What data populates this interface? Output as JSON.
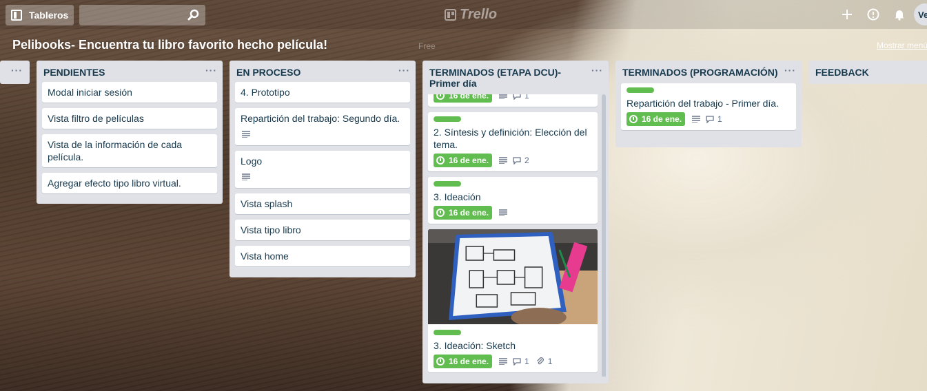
{
  "header": {
    "boards_label": "Tableros",
    "search_placeholder": "",
    "logo_text": "Trello",
    "avatar_initials": "Ve"
  },
  "board": {
    "title": "Pelibooks- Encuentra tu libro favorito hecho película!",
    "faint_label": "Free",
    "show_menu": "Mostrar menú"
  },
  "lists": {
    "pendientes": {
      "title": "PENDIENTES",
      "cards": [
        {
          "title": "Modal iniciar sesión"
        },
        {
          "title": "Vista filtro de películas"
        },
        {
          "title": "Vista de la información de cada película."
        },
        {
          "title": "Agregar efecto tipo libro virtual."
        }
      ]
    },
    "en_proceso": {
      "title": "EN PROCESO",
      "cards": [
        {
          "title": "4. Prototipo"
        },
        {
          "title": "Repartición del trabajo: Segundo día."
        },
        {
          "title": "Logo"
        },
        {
          "title": "Vista splash"
        },
        {
          "title": "Vista tipo libro"
        },
        {
          "title": "Vista home"
        }
      ]
    },
    "terminados_dcu": {
      "title": "TERMINADOS (ETAPA DCU)- Primer día",
      "cards": [
        {
          "due": "16 de ene.",
          "comments": "1"
        },
        {
          "title": "2. Síntesis y definición: Elección del tema.",
          "due": "16 de ene.",
          "comments": "2"
        },
        {
          "title": "3. Ideación",
          "due": "16 de ene."
        },
        {
          "title": "3. Ideación: Sketch",
          "due": "16 de ene.",
          "comments": "1",
          "attachments": "1"
        }
      ]
    },
    "terminados_prog": {
      "title": "TERMINADOS (PROGRAMACIÓN)",
      "cards": [
        {
          "title": "Repartición del trabajo - Primer día.",
          "due": "16 de ene.",
          "comments": "1"
        }
      ]
    },
    "feedback": {
      "title": "FEEDBACK"
    }
  },
  "colors": {
    "label_green": "#61bd4f",
    "list_bg": "#dfe1e6",
    "card_text": "#17394d"
  }
}
